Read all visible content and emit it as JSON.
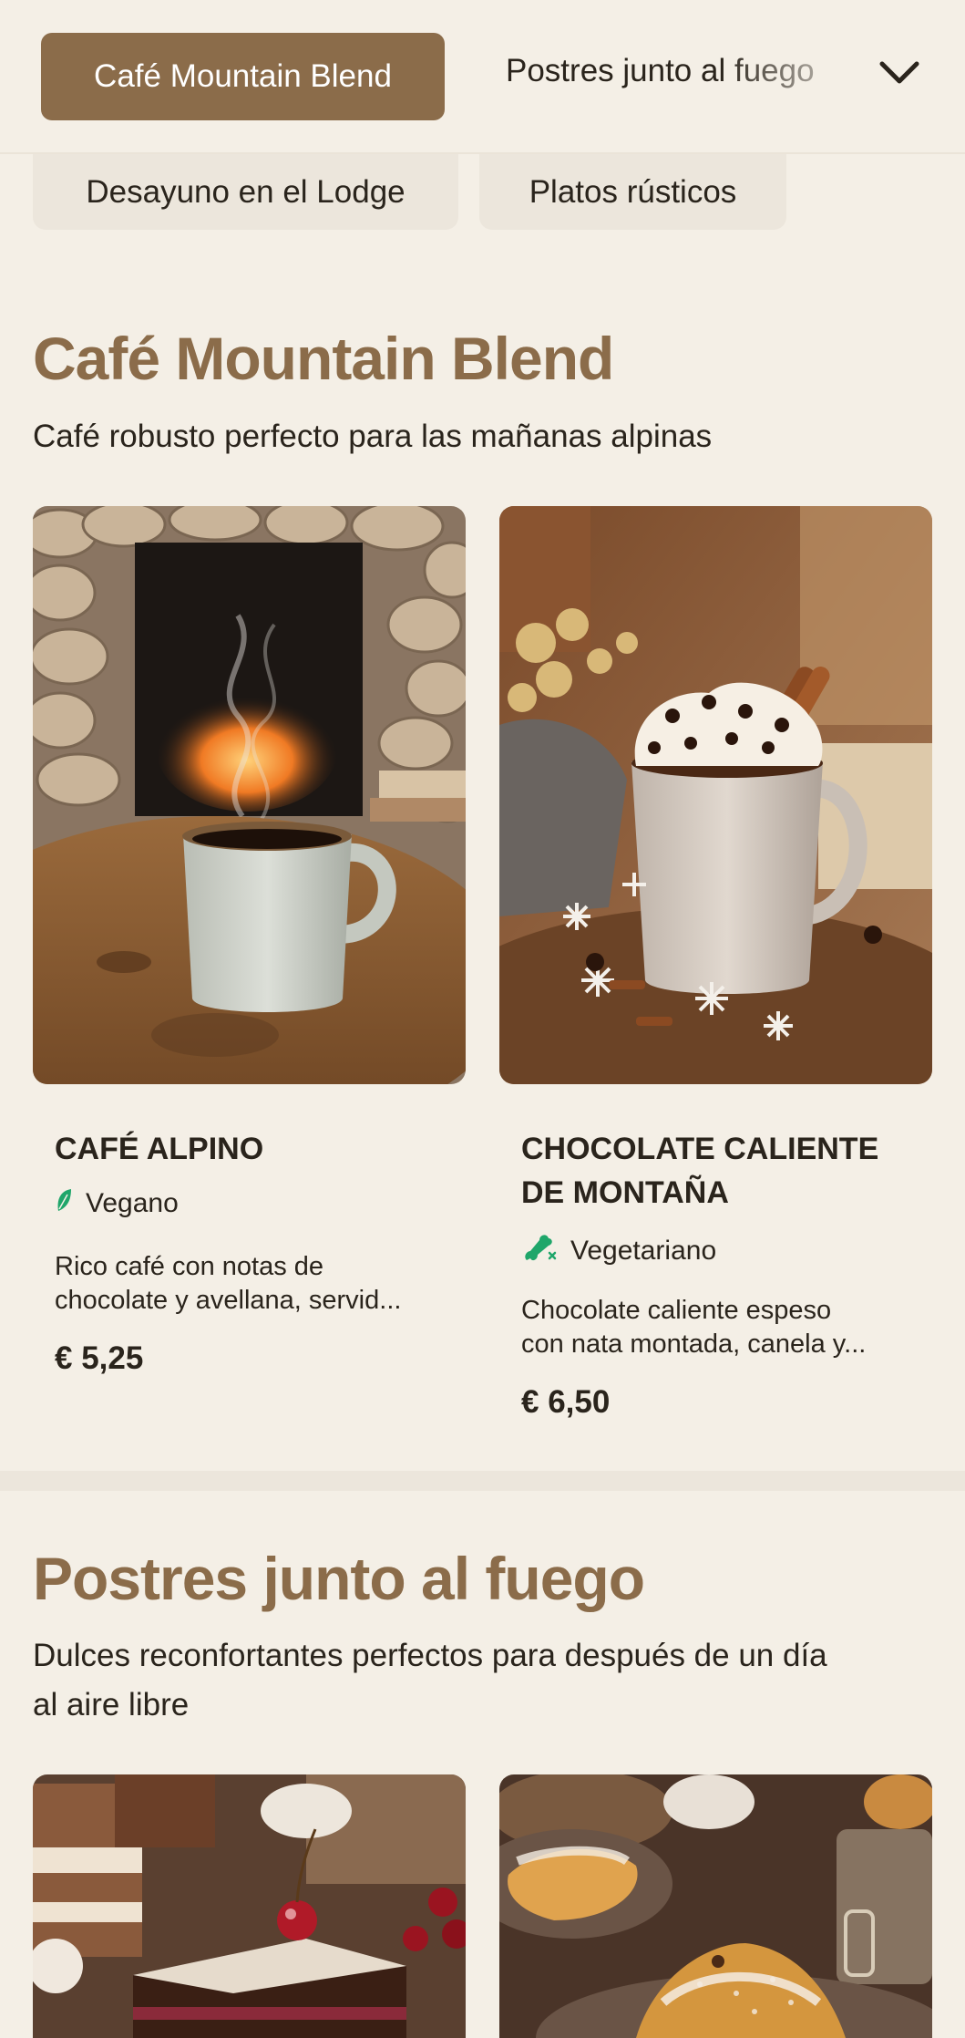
{
  "nav": {
    "active_tab": "Café Mountain Blend",
    "next_tab": "Postres junto al fuego",
    "expand_icon": "chevron-down-icon",
    "pills": [
      "Desayuno en el Lodge",
      "Platos rústicos"
    ]
  },
  "sections": [
    {
      "title": "Café Mountain Blend",
      "subtitle": "Café robusto perfecto para las mañanas alpinas",
      "items": [
        {
          "name": "CAFÉ ALPINO",
          "diet": "Vegano",
          "diet_icon": "leaf-icon",
          "description_lines": [
            "Rico café con notas de",
            "chocolate y avellana, servid..."
          ],
          "price": "€ 5,25"
        },
        {
          "name_lines": [
            "CHOCOLATE CALIENTE",
            "DE MONTAÑA"
          ],
          "diet": "Vegetariano",
          "diet_icon": "no-meat-icon",
          "description_lines": [
            "Chocolate caliente espeso",
            "con nata montada, canela y..."
          ],
          "price": "€ 6,50"
        }
      ]
    },
    {
      "title": "Postres junto al fuego",
      "subtitle_lines": [
        "Dulces reconfortantes perfectos para después de un día",
        "al aire libre"
      ]
    }
  ],
  "colors": {
    "accent": "#8b6c4a",
    "background": "#f4efe6",
    "pill_bg": "#ece6dc",
    "diet_green": "#1fa66a"
  }
}
